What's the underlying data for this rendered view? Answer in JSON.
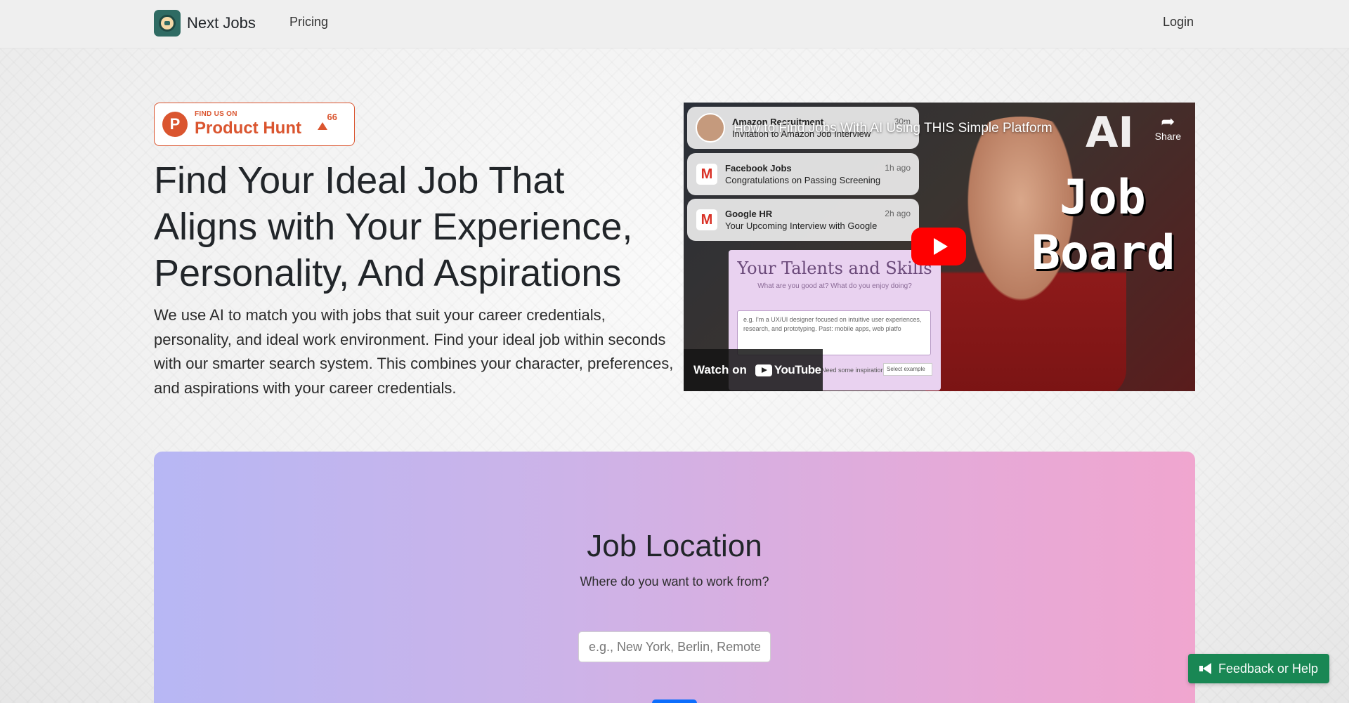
{
  "nav": {
    "brand": "Next Jobs",
    "pricing": "Pricing",
    "login": "Login"
  },
  "product_hunt": {
    "small": "FIND US ON",
    "big": "Product Hunt",
    "votes": "66",
    "logo_letter": "P"
  },
  "hero": {
    "title": "Find Your Ideal Job That Aligns with Your Experience, Personality, And Aspirations",
    "description": "We use AI to match you with jobs that suit your career credentials, personality, and ideal work environment. Find your ideal job within seconds with our smarter search system. This combines your character, preferences, and aspirations with your career credentials."
  },
  "video": {
    "title": "How to Find Jobs With AI Using THIS Simple Platform",
    "share": "Share",
    "overlay_ai": "AI",
    "overlay_job": "Job",
    "overlay_board": "Board",
    "watch_on": "Watch on",
    "youtube": "YouTube",
    "notifications": [
      {
        "title": "Amazon Recruitment",
        "time": "30m",
        "text": "Invitation to Amazon Job Interview"
      },
      {
        "title": "Facebook Jobs",
        "time": "1h ago",
        "text": "Congratulations on Passing Screening"
      },
      {
        "title": "Google HR",
        "time": "2h ago",
        "text": "Your Upcoming Interview with Google"
      }
    ],
    "talents": {
      "title": "Your Talents and Skills",
      "subtitle": "What are you good at? What do you enjoy doing?",
      "box_text": "e.g. I'm a UX/UI designer focused on intuitive user experiences, research, and prototyping. Past: mobile apps, web platfo",
      "footer": "Need some inspiration?",
      "select": "Select example"
    }
  },
  "location": {
    "title": "Job Location",
    "subtitle": "Where do you want to work from?",
    "placeholder": "e.g., New York, Berlin, Remote"
  },
  "feedback": {
    "label": "Feedback or Help"
  },
  "colors": {
    "product_hunt": "#da552f",
    "feedback": "#198754",
    "primary": "#0d6efd"
  }
}
